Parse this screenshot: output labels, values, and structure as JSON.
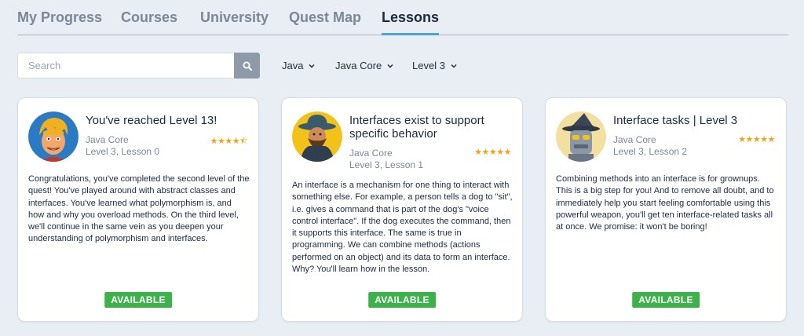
{
  "tabs": [
    {
      "label": "My Progress"
    },
    {
      "label": "Courses"
    },
    {
      "label": "University"
    },
    {
      "label": "Quest Map"
    },
    {
      "label": "Lessons",
      "active": true
    }
  ],
  "search": {
    "placeholder": "Search",
    "value": "",
    "icon": "search-icon"
  },
  "filters": [
    {
      "label": "Java",
      "icon": "chevron-down-icon"
    },
    {
      "label": "Java Core",
      "icon": "chevron-down-icon"
    },
    {
      "label": "Level 3",
      "icon": "chevron-down-icon"
    }
  ],
  "cards": [
    {
      "title": "You've reached Level 13!",
      "course": "Java Core",
      "lesson": "Level 3, Lesson 0",
      "rating": 4.5,
      "stars": "★★★★⯪",
      "description": "Congratulations, you've completed the second level of the quest! You've played around with abstract classes and interfaces. You've learned what polymorphism is, and how and why you overload methods. On the third level, we'll continue in the same vein as you deepen your understanding of polymorphism and interfaces.",
      "status": "AVAILABLE"
    },
    {
      "title": "Interfaces exist to support specific behavior",
      "course": "Java Core",
      "lesson": "Level 3, Lesson 1",
      "rating": 5,
      "stars": "★★★★★",
      "description": "An interface is a mechanism for one thing to interact with something else. For example, a person tells a dog to \"sit\", i.e. gives a command that is part of the dog's \"voice control interface\". If the dog executes the command, then it supports this interface. The same is true in programming. We can combine methods (actions performed on an object) and its data to form an interface. Why? You'll learn how in the lesson.",
      "status": "AVAILABLE"
    },
    {
      "title": "Interface tasks | Level 3",
      "course": "Java Core",
      "lesson": "Level 3, Lesson 2",
      "rating": 5,
      "stars": "★★★★★",
      "description": "Combining methods into an interface is for grownups. This is a big step for you! And to remove all doubt, and to immediately help you start feeling comfortable using this powerful weapon, you'll get ten interface-related tasks all at once. We promise: it won't be boring!",
      "status": "AVAILABLE"
    }
  ],
  "colors": {
    "accent": "#4aa3df",
    "available": "#3db14a",
    "star": "#f3a21a"
  }
}
